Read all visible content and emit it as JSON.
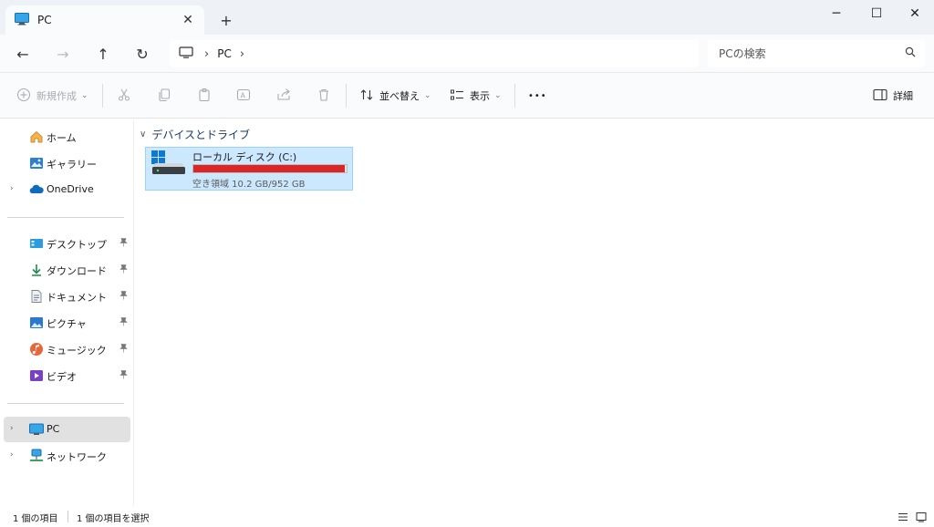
{
  "tab": {
    "title": "PC",
    "close_glyph": "✕",
    "new_tab_glyph": "+"
  },
  "window": {
    "minimize_glyph": "─",
    "maximize_glyph": "☐",
    "close_glyph": "✕"
  },
  "nav": {
    "back_glyph": "←",
    "forward_glyph": "→",
    "up_glyph": "↑",
    "refresh_glyph": "↻"
  },
  "address": {
    "separator": "›",
    "crumbs": [
      "PC"
    ]
  },
  "search": {
    "placeholder": "PCの検索"
  },
  "commands": {
    "new": "新規作成",
    "sort": "並べ替え",
    "view": "表示",
    "more": "•••",
    "details": "詳細"
  },
  "sidebar": {
    "expander_glyph": "›",
    "pin_glyph": "📌",
    "items": [
      {
        "label": "ホーム",
        "icon": "home-icon"
      },
      {
        "label": "ギャラリー",
        "icon": "gallery-icon"
      },
      {
        "label": "OneDrive",
        "icon": "onedrive-icon"
      },
      {
        "label": "デスクトップ",
        "icon": "desktop-icon",
        "pinned": true
      },
      {
        "label": "ダウンロード",
        "icon": "download-icon",
        "pinned": true
      },
      {
        "label": "ドキュメント",
        "icon": "documents-icon",
        "pinned": true
      },
      {
        "label": "ピクチャ",
        "icon": "pictures-icon",
        "pinned": true
      },
      {
        "label": "ミュージック",
        "icon": "music-icon",
        "pinned": true
      },
      {
        "label": "ビデオ",
        "icon": "videos-icon",
        "pinned": true
      },
      {
        "label": "PC",
        "icon": "pc-icon",
        "selected": true
      },
      {
        "label": "ネットワーク",
        "icon": "network-icon"
      }
    ]
  },
  "content": {
    "group_title": "デバイスとドライブ",
    "group_chevron": "∨",
    "drive": {
      "name": "ローカル ディスク (C:)",
      "space_text": "空き領域 10.2 GB/952 GB",
      "used_fraction": 0.989,
      "bar_color": "#da2626"
    }
  },
  "status": {
    "item_count": "1 個の項目",
    "selected_count": "1 個の項目を選択"
  }
}
